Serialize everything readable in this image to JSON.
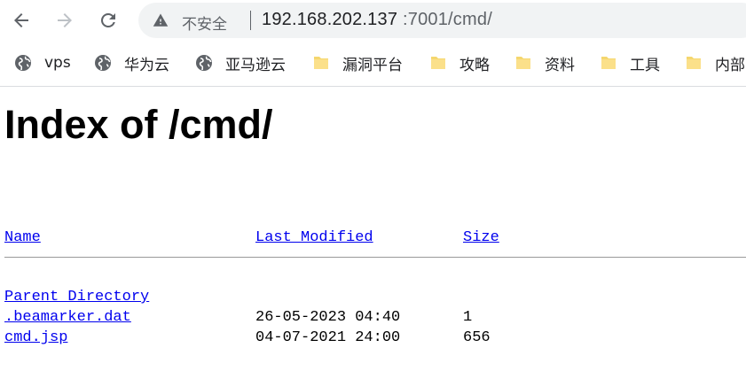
{
  "browser": {
    "security_label": "不安全",
    "url_host": "192.168.202.137",
    "url_rest": ":7001/cmd/"
  },
  "bookmarks": [
    {
      "label": "vps",
      "icon": "globe-icon"
    },
    {
      "label": "华为云",
      "icon": "globe-icon"
    },
    {
      "label": "亚马逊云",
      "icon": "globe-icon"
    },
    {
      "label": "漏洞平台",
      "icon": "folder-icon"
    },
    {
      "label": "攻略",
      "icon": "folder-icon"
    },
    {
      "label": "资料",
      "icon": "folder-icon"
    },
    {
      "label": "工具",
      "icon": "folder-icon"
    },
    {
      "label": "内部",
      "icon": "folder-icon"
    }
  ],
  "page": {
    "title": "Index of /cmd/",
    "columns": {
      "name": "Name",
      "modified": "Last Modified",
      "size": "Size"
    },
    "parent_link": "Parent Directory",
    "files": [
      {
        "name": ".beamarker.dat",
        "modified": "26-05-2023 04:40",
        "size": "1"
      },
      {
        "name": "cmd.jsp",
        "modified": "04-07-2021 24:00",
        "size": "656"
      }
    ]
  },
  "colors": {
    "link": "#0000ee",
    "chrome_icon": "#5f6368",
    "folder": "#f5d76e"
  }
}
